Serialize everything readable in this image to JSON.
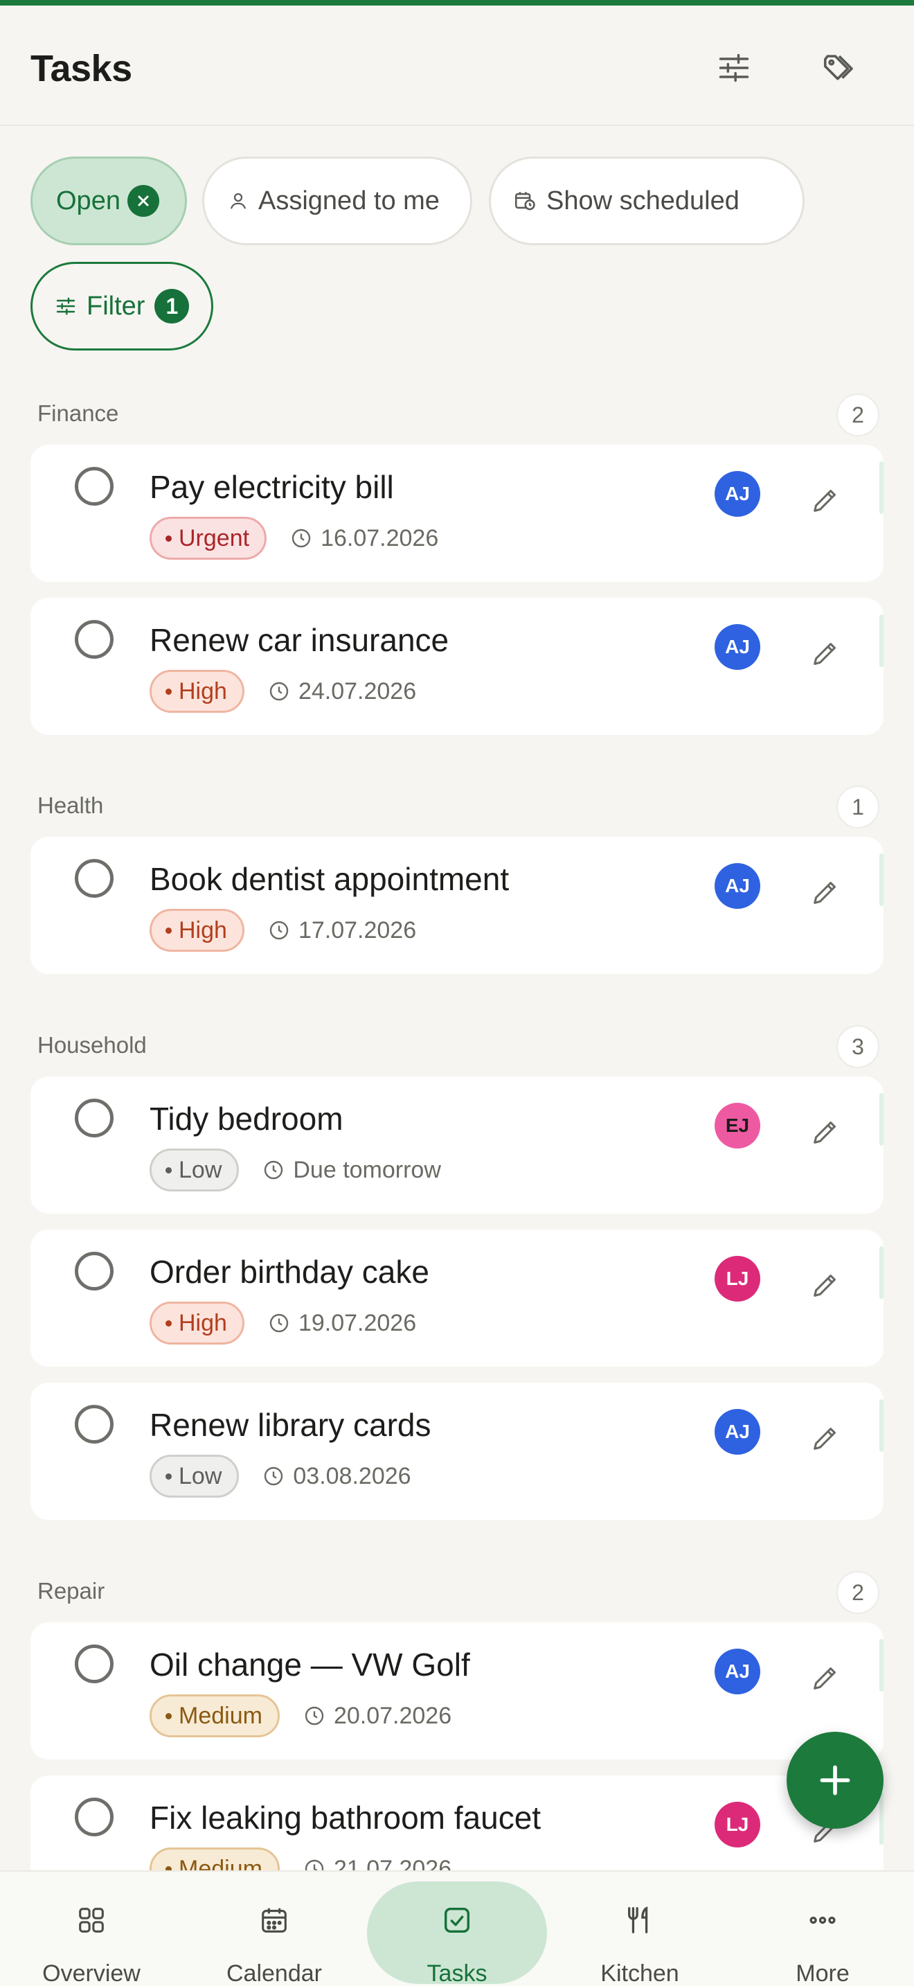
{
  "header": {
    "title": "Tasks"
  },
  "chips": {
    "open": "Open",
    "assigned": "Assigned to me",
    "scheduled": "Show scheduled",
    "filter": "Filter",
    "filter_count": "1"
  },
  "colors": {
    "accent": "#1b7a3c",
    "urgent": "#a8262a",
    "high": "#b23e1d",
    "medium": "#8a5a12",
    "low": "#5d5d5a"
  },
  "sections": [
    {
      "name": "Finance",
      "count": "2",
      "tasks": [
        {
          "title": "Pay electricity bill",
          "priority": "Urgent",
          "due": "16.07.2026",
          "assignee": "AJ"
        },
        {
          "title": "Renew car insurance",
          "priority": "High",
          "due": "24.07.2026",
          "assignee": "AJ"
        }
      ]
    },
    {
      "name": "Health",
      "count": "1",
      "tasks": [
        {
          "title": "Book dentist appointment",
          "priority": "High",
          "due": "17.07.2026",
          "assignee": "AJ"
        }
      ]
    },
    {
      "name": "Household",
      "count": "3",
      "tasks": [
        {
          "title": "Tidy bedroom",
          "priority": "Low",
          "due": "Due tomorrow",
          "assignee": "EJ"
        },
        {
          "title": "Order birthday cake",
          "priority": "High",
          "due": "19.07.2026",
          "assignee": "LJ"
        },
        {
          "title": "Renew library cards",
          "priority": "Low",
          "due": "03.08.2026",
          "assignee": "AJ"
        }
      ]
    },
    {
      "name": "Repair",
      "count": "2",
      "tasks": [
        {
          "title": "Oil change — VW Golf",
          "priority": "Medium",
          "due": "20.07.2026",
          "assignee": "AJ"
        },
        {
          "title": "Fix leaking bathroom faucet",
          "priority": "Medium",
          "due": "21.07.2026",
          "assignee": "LJ"
        }
      ]
    }
  ],
  "nav": {
    "overview": "Overview",
    "calendar": "Calendar",
    "tasks": "Tasks",
    "kitchen": "Kitchen",
    "more": "More"
  }
}
